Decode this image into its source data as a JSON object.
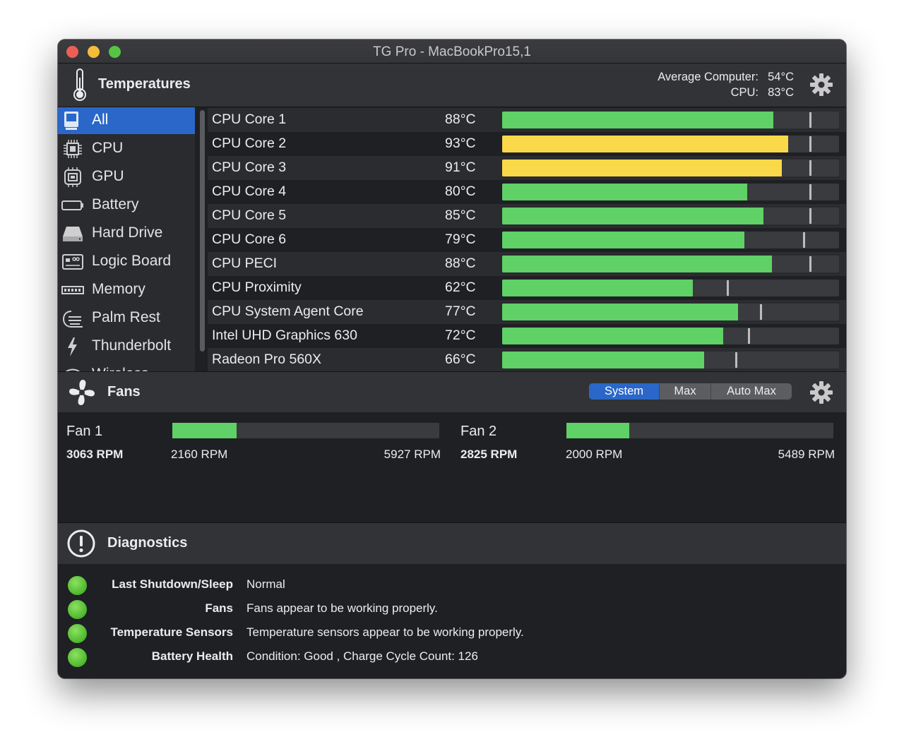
{
  "window": {
    "title": "TG Pro - MacBookPro15,1"
  },
  "temperatures": {
    "title": "Temperatures",
    "average_computer_label": "Average Computer:",
    "average_computer_value": "54°C",
    "cpu_label": "CPU:",
    "cpu_value": "83°C"
  },
  "sidebar": {
    "items": [
      {
        "label": "All",
        "icon": "all-icon",
        "selected": true
      },
      {
        "label": "CPU",
        "icon": "cpu-chip-icon"
      },
      {
        "label": "GPU",
        "icon": "gpu-chip-icon"
      },
      {
        "label": "Battery",
        "icon": "battery-icon"
      },
      {
        "label": "Hard Drive",
        "icon": "hard-drive-icon"
      },
      {
        "label": "Logic Board",
        "icon": "logic-board-icon"
      },
      {
        "label": "Memory",
        "icon": "memory-icon"
      },
      {
        "label": "Palm Rest",
        "icon": "palm-rest-icon"
      },
      {
        "label": "Thunderbolt",
        "icon": "thunderbolt-icon"
      },
      {
        "label": "Wireless",
        "icon": "wireless-icon"
      }
    ]
  },
  "sensors": [
    {
      "name": "CPU Core 1",
      "temp": "88°C",
      "level": 0.804,
      "marker": 0.912,
      "color": "#5fd166"
    },
    {
      "name": "CPU Core 2",
      "temp": "93°C",
      "level": 0.849,
      "marker": 0.912,
      "color": "#f9d949"
    },
    {
      "name": "CPU Core 3",
      "temp": "91°C",
      "level": 0.83,
      "marker": 0.912,
      "color": "#f9d949"
    },
    {
      "name": "CPU Core 4",
      "temp": "80°C",
      "level": 0.728,
      "marker": 0.912,
      "color": "#5fd166"
    },
    {
      "name": "CPU Core 5",
      "temp": "85°C",
      "level": 0.776,
      "marker": 0.912,
      "color": "#5fd166"
    },
    {
      "name": "CPU Core 6",
      "temp": "79°C",
      "level": 0.719,
      "marker": 0.893,
      "color": "#5fd166"
    },
    {
      "name": "CPU PECI",
      "temp": "88°C",
      "level": 0.8,
      "marker": 0.912,
      "color": "#5fd166"
    },
    {
      "name": "CPU Proximity",
      "temp": "62°C",
      "level": 0.566,
      "marker": 0.667,
      "color": "#5fd166"
    },
    {
      "name": "CPU System Agent Core",
      "temp": "77°C",
      "level": 0.7,
      "marker": 0.765,
      "color": "#5fd166"
    },
    {
      "name": "Intel UHD Graphics 630",
      "temp": "72°C",
      "level": 0.656,
      "marker": 0.73,
      "color": "#5fd166"
    },
    {
      "name": "Radeon Pro 560X",
      "temp": "66°C",
      "level": 0.6,
      "marker": 0.692,
      "color": "#5fd166"
    }
  ],
  "fans": {
    "title": "Fans",
    "modes": [
      "System",
      "Max",
      "Auto Max"
    ],
    "selected_mode": "System",
    "items": [
      {
        "name": "Fan 1",
        "rpm": "3063 RPM",
        "min": "2160 RPM",
        "max": "5927 RPM",
        "level": 0.24
      },
      {
        "name": "Fan 2",
        "rpm": "2825 RPM",
        "min": "2000 RPM",
        "max": "5489 RPM",
        "level": 0.236
      }
    ]
  },
  "diagnostics": {
    "title": "Diagnostics",
    "items": [
      {
        "label": "Last Shutdown/Sleep",
        "value": "Normal",
        "status_color": "#5fc235"
      },
      {
        "label": "Fans",
        "value": "Fans appear to be working properly.",
        "status_color": "#5fc235"
      },
      {
        "label": "Temperature Sensors",
        "value": "Temperature sensors appear to be working properly.",
        "status_color": "#5fc235"
      },
      {
        "label": "Battery Health",
        "value": "Condition: Good , Charge Cycle Count: 126",
        "status_color": "#5fc235"
      }
    ]
  }
}
